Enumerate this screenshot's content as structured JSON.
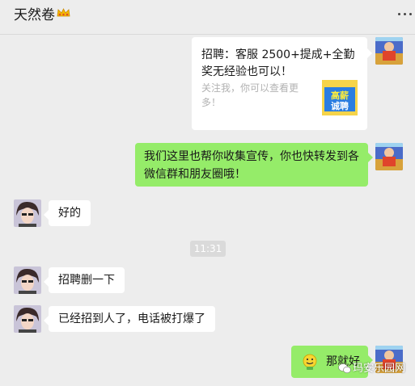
{
  "header": {
    "title": "天然卷",
    "crown_icon": "crown-icon",
    "more_icon": "more-dots-icon"
  },
  "messages": {
    "card": {
      "title": "招聘：客服  2500+提成+全勤奖无经验也可以！",
      "description": "关注我，你可以查看更多！",
      "thumb_text_1": "高薪",
      "thumb_text_2": "诚聘"
    },
    "m2": "我们这里也帮你收集宣传，你也快转发到各微信群和朋友圈哦！",
    "m3": "好的",
    "time": "11:31",
    "m4": "招聘删一下",
    "m5": "已经招到人了，电话被打爆了",
    "m6": "那就好"
  },
  "watermark": "玛安乐园网",
  "colors": {
    "background": "#ededed",
    "self_bubble": "#95ec69",
    "other_bubble": "#ffffff"
  }
}
